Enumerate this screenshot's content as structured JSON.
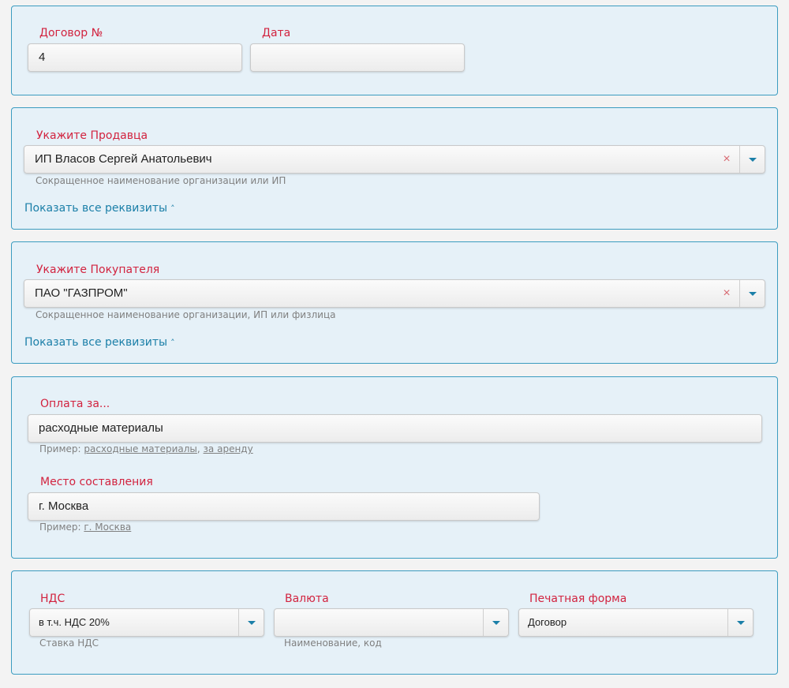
{
  "contract": {
    "number_label": "Договор №",
    "number_value": "4",
    "date_label": "Дата",
    "date_value": ""
  },
  "seller": {
    "label": "Укажите Продавца",
    "value": "ИП Власов Сергей Анатольевич",
    "help": "Сокращенное наименование организации или ИП",
    "toggle": "Показать все реквизиты",
    "clear_icon": "×"
  },
  "buyer": {
    "label": "Укажите Покупателя",
    "value": "ПАО \"ГАЗПРОМ\"",
    "help": "Сокращенное наименование организации, ИП или физлица",
    "toggle": "Показать все реквизиты",
    "clear_icon": "×"
  },
  "payment": {
    "label": "Оплата за...",
    "value": "расходные материалы",
    "help_prefix": "Пример:",
    "examples": [
      "расходные материалы",
      "за аренду"
    ]
  },
  "place": {
    "label": "Место составления",
    "value": "г. Москва",
    "help_prefix": "Пример:",
    "examples": [
      "г. Москва"
    ]
  },
  "vat": {
    "label": "НДС",
    "value": "в т.ч. НДС 20%",
    "help": "Ставка НДС"
  },
  "currency": {
    "label": "Валюта",
    "value": "",
    "help": "Наименование, код"
  },
  "print_form": {
    "label": "Печатная форма",
    "value": "Договор"
  },
  "colors": {
    "label": "#d2233f",
    "accent": "#1b7fa8",
    "panel_bg": "#e6f1f8",
    "panel_border": "#3b9cc0"
  }
}
